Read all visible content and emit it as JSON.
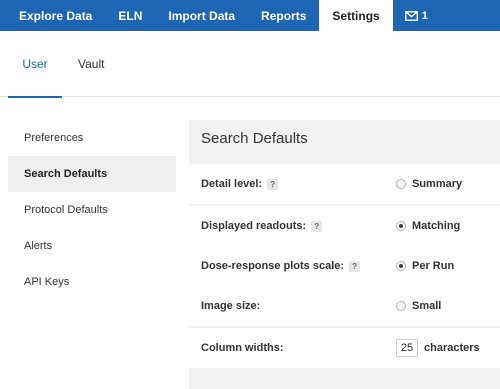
{
  "nav": {
    "items": [
      "Explore Data",
      "ELN",
      "Import Data",
      "Reports",
      "Settings"
    ],
    "active": "Settings",
    "mail_icon": "envelope-icon",
    "mail_count": "1",
    "color": "#1c66b3"
  },
  "subtabs": {
    "user": "User",
    "vault": "Vault",
    "active": "User"
  },
  "sidebar": {
    "items": [
      "Preferences",
      "Search Defaults",
      "Protocol Defaults",
      "Alerts",
      "API Keys"
    ],
    "active": "Search Defaults"
  },
  "main": {
    "title": "Search Defaults",
    "help_glyph": "?",
    "rows": [
      {
        "label": "Detail level:",
        "help": true,
        "control": "radio",
        "checked": false,
        "value": "Summary"
      },
      {
        "label": "Displayed readouts:",
        "help": true,
        "control": "radio",
        "checked": true,
        "value": "Matching"
      },
      {
        "label": "Dose-response plots scale:",
        "help": true,
        "control": "radio",
        "checked": true,
        "value": "Per Run"
      },
      {
        "label": "Image size:",
        "help": false,
        "control": "radio",
        "checked": false,
        "value": "Small"
      },
      {
        "label": "Column widths:",
        "help": false,
        "control": "number",
        "input_value": "25",
        "unit": "characters"
      }
    ]
  }
}
